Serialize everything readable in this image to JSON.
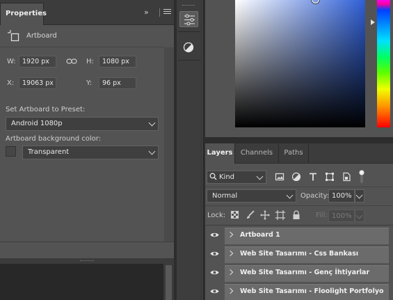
{
  "properties": {
    "tab_label": "Properties",
    "collapse_glyph": "»",
    "section_title": "Artboard",
    "icons": {
      "section": "artboard-icon",
      "link": "link-icon",
      "menu": "menu-icon",
      "collapse": "collapse-icon"
    },
    "w_label": "W:",
    "w_value": "1920 px",
    "h_label": "H:",
    "h_value": "1080 px",
    "x_label": "X:",
    "x_value": "19063 px",
    "y_label": "Y:",
    "y_value": "96 px",
    "preset_label": "Set Artboard to Preset:",
    "preset_value": "Android 1080p",
    "bg_label": "Artboard background color:",
    "bg_value": "Transparent"
  },
  "color_picker": {
    "hue_top_color": "#ff00f0",
    "field_base_color": "#2f5fd6"
  },
  "layers_panel": {
    "tabs": [
      "Layers",
      "Channels",
      "Paths"
    ],
    "active_tab": "Layers",
    "filter_kind": "Kind",
    "blend_mode": "Normal",
    "opacity_label": "Opacity:",
    "opacity_value": "100%",
    "lock_label": "Lock:",
    "fill_label": "Fill:",
    "fill_value": "100%",
    "filter_icons": [
      "image-filter-icon",
      "adjustment-filter-icon",
      "type-filter-icon",
      "shape-filter-icon",
      "smart-object-filter-icon"
    ],
    "lock_icons": [
      "lock-pixels-icon",
      "lock-paint-icon",
      "lock-position-icon",
      "lock-artboard-icon",
      "lock-all-icon"
    ],
    "layers": [
      {
        "name": "Artboard 1",
        "visible": true
      },
      {
        "name": "Web Site Tasarımı - Css Bankası",
        "visible": true
      },
      {
        "name": "Web Site Tasarımı - Genç İhtiyarlar",
        "visible": true
      },
      {
        "name": "Web Site Tasarımı - Floolight Portfolyo",
        "visible": true
      }
    ]
  },
  "colors": {
    "panel_bg": "#535353",
    "header_bg": "#3c3c3c",
    "layer_row_bg": "#6b6b6b"
  }
}
